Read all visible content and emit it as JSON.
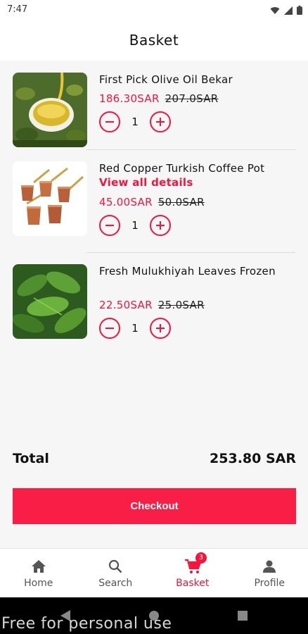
{
  "status_bar": {
    "time": "7:47"
  },
  "header": {
    "title": "Basket"
  },
  "items": [
    {
      "name": "First Pick Olive Oil Bekar",
      "details_link": "",
      "price": "186.30SAR",
      "old_price": "207.0SAR",
      "quantity": "1"
    },
    {
      "name": "Red Copper Turkish Coffee Pot",
      "details_link": "View all details",
      "price": "45.00SAR",
      "old_price": "50.0SAR",
      "quantity": "1"
    },
    {
      "name": "Fresh Mulukhiyah Leaves Frozen",
      "details_link": "",
      "price": "22.50SAR",
      "old_price": "25.0SAR",
      "quantity": "1"
    }
  ],
  "summary": {
    "total_label": "Total",
    "total_value": "253.80 SAR"
  },
  "checkout": {
    "label": "Checkout"
  },
  "bottom_nav": {
    "home": "Home",
    "search": "Search",
    "basket": "Basket",
    "basket_badge": "3",
    "profile": "Profile"
  },
  "watermark": "Free for personal use",
  "colors": {
    "accent": "#f4143c",
    "checkout_bg": "#f81e46"
  }
}
